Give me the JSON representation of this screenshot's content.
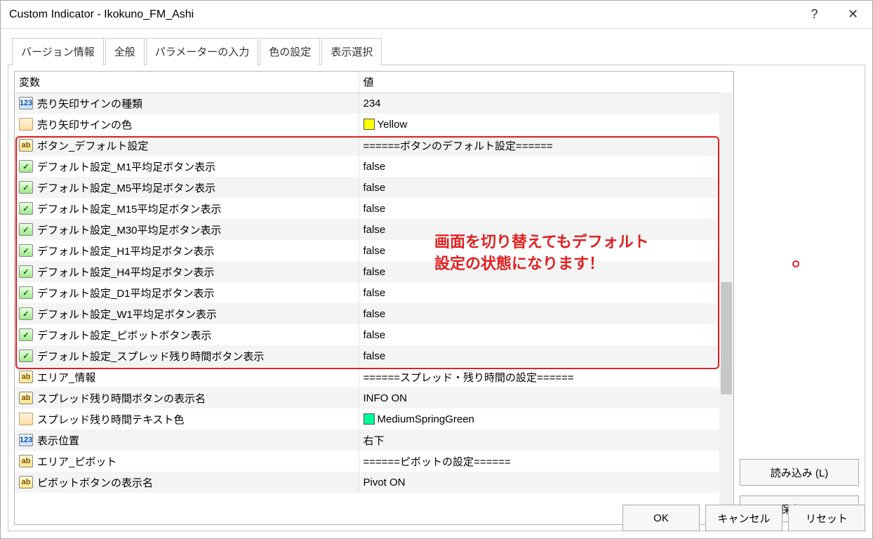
{
  "window": {
    "title": "Custom Indicator - Ikokuno_FM_Ashi",
    "help": "?",
    "close": "✕"
  },
  "tabs": [
    "バージョン情報",
    "全般",
    "パラメーターの入力",
    "色の設定",
    "表示選択"
  ],
  "active_tab": 2,
  "columns": {
    "variable": "変数",
    "value": "値"
  },
  "rows": [
    {
      "icon": "num",
      "name": "売り矢印サインの種類",
      "value": "234"
    },
    {
      "icon": "clr",
      "name": "売り矢印サインの色",
      "value": "Yellow",
      "swatch": "#ffff00"
    },
    {
      "icon": "str",
      "name": "ボタン_デフォルト設定",
      "value": "======ボタンのデフォルト設定======"
    },
    {
      "icon": "bool",
      "name": "デフォルト設定_M1平均足ボタン表示",
      "value": "false"
    },
    {
      "icon": "bool",
      "name": "デフォルト設定_M5平均足ボタン表示",
      "value": "false"
    },
    {
      "icon": "bool",
      "name": "デフォルト設定_M15平均足ボタン表示",
      "value": "false"
    },
    {
      "icon": "bool",
      "name": "デフォルト設定_M30平均足ボタン表示",
      "value": "false"
    },
    {
      "icon": "bool",
      "name": "デフォルト設定_H1平均足ボタン表示",
      "value": "false"
    },
    {
      "icon": "bool",
      "name": "デフォルト設定_H4平均足ボタン表示",
      "value": "false"
    },
    {
      "icon": "bool",
      "name": "デフォルト設定_D1平均足ボタン表示",
      "value": "false"
    },
    {
      "icon": "bool",
      "name": "デフォルト設定_W1平均足ボタン表示",
      "value": "false"
    },
    {
      "icon": "bool",
      "name": "デフォルト設定_ピボットボタン表示",
      "value": "false"
    },
    {
      "icon": "bool",
      "name": "デフォルト設定_スプレッド残り時間ボタン表示",
      "value": "false"
    },
    {
      "icon": "str",
      "name": "エリア_情報",
      "value": "======スプレッド・残り時間の設定======"
    },
    {
      "icon": "str",
      "name": "スプレッド残り時間ボタンの表示名",
      "value": "INFO ON"
    },
    {
      "icon": "clr",
      "name": "スプレッド残り時間テキスト色",
      "value": "MediumSpringGreen",
      "swatch": "#00fa9a"
    },
    {
      "icon": "num",
      "name": "表示位置",
      "value": "右下"
    },
    {
      "icon": "str",
      "name": "エリア_ピボット",
      "value": "======ピボットの設定======"
    },
    {
      "icon": "str",
      "name": "ピボットボタンの表示名",
      "value": "Pivot ON"
    }
  ],
  "annotation": "画面を切り替えてもデフォルト\n設定の状態になります！",
  "buttons": {
    "load": "読み込み (L)",
    "save": "保存 (S)",
    "ok": "OK",
    "cancel": "キャンセル",
    "reset": "リセット"
  },
  "icon_labels": {
    "num": "123",
    "str": "ab",
    "bool": "✓",
    "clr": ""
  }
}
